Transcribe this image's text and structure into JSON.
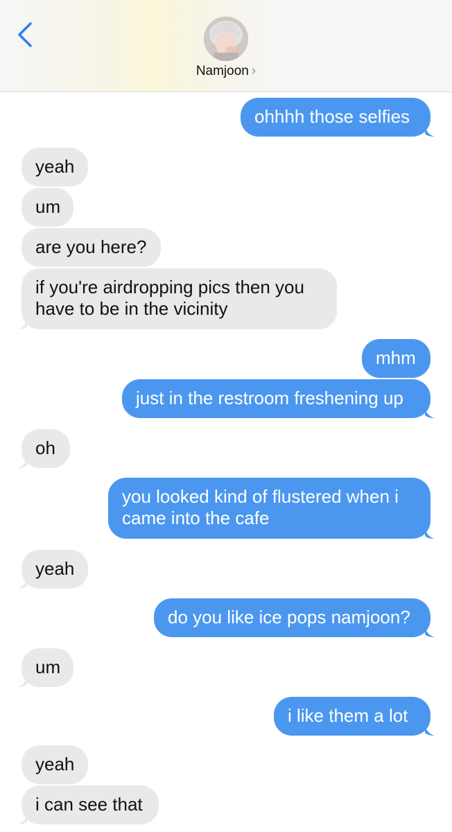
{
  "header": {
    "contact_name": "Namjoon",
    "accent_color": "#2f7cf6"
  },
  "messages": [
    {
      "dir": "out",
      "text": "ohhhh those selfies"
    },
    {
      "dir": "in",
      "text": "yeah"
    },
    {
      "dir": "in",
      "text": "um"
    },
    {
      "dir": "in",
      "text": "are you here?"
    },
    {
      "dir": "in",
      "lines": [
        "if you're airdropping pics then you",
        "have to be in the vicinity"
      ]
    },
    {
      "dir": "out",
      "text": "mhm"
    },
    {
      "dir": "out",
      "text": "just in the restroom freshening up"
    },
    {
      "dir": "in",
      "text": "oh"
    },
    {
      "dir": "out",
      "lines": [
        "you looked kind of flustered when i",
        "came into the cafe"
      ]
    },
    {
      "dir": "in",
      "text": "yeah"
    },
    {
      "dir": "out",
      "text": "do you like ice pops namjoon?"
    },
    {
      "dir": "in",
      "text": "um"
    },
    {
      "dir": "out",
      "text": "i like them a lot"
    },
    {
      "dir": "in",
      "text": "yeah"
    },
    {
      "dir": "in",
      "text": "i can see that"
    }
  ],
  "colors": {
    "incoming_bubble": "#e9e9eb",
    "outgoing_bubble": "#4b97ef"
  }
}
